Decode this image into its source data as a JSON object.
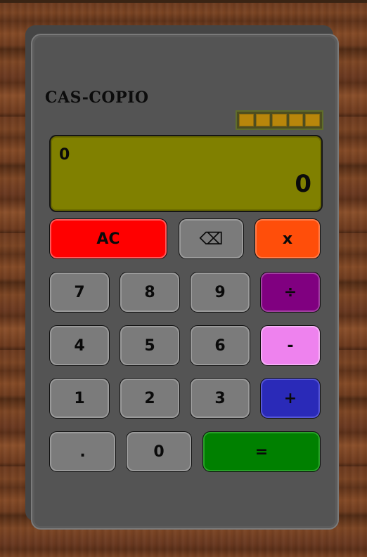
{
  "calculator": {
    "brand": "CAS-COPIO",
    "solar_cells": 5,
    "display": {
      "expression": "0",
      "result": "0"
    },
    "keys": {
      "ac": "AC",
      "backspace": "⌫",
      "multiply": "x",
      "seven": "7",
      "eight": "8",
      "nine": "9",
      "divide": "÷",
      "four": "4",
      "five": "5",
      "six": "6",
      "subtract": "-",
      "one": "1",
      "two": "2",
      "three": "3",
      "add": "+",
      "decimal": ".",
      "zero": "0",
      "equals": "="
    },
    "colors": {
      "ac": "#ff0000",
      "multiply": "#ff4e0a",
      "divide": "#800080",
      "subtract": "#ee82ee",
      "add": "#2a2ab8",
      "equals": "#008000",
      "display": "#808000",
      "solar": "#b8860b"
    }
  }
}
